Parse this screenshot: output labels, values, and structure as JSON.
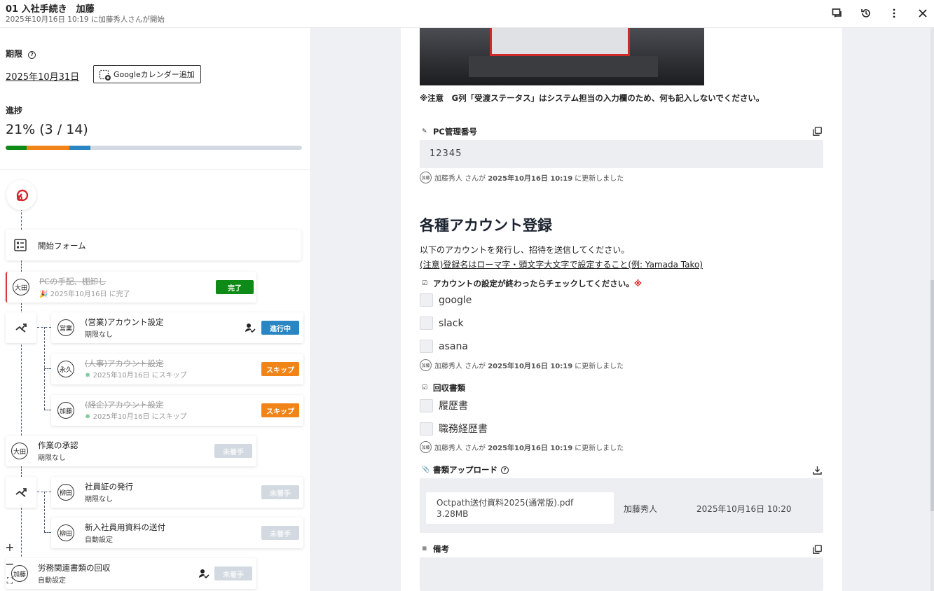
{
  "header": {
    "title": "01 入社手続き　加藤",
    "subtitle": "2025年10月16日 10:19 に加藤秀人さんが開始"
  },
  "deadline": {
    "label": "期限",
    "date": "2025年10月31日",
    "gcal_label": "Googleカレンダー追加"
  },
  "progress": {
    "label": "進捗",
    "value_text": "21% (3 / 14)",
    "done": 3,
    "total": 14,
    "segments": [
      {
        "color": "#0e8a16",
        "fraction": 0.0714
      },
      {
        "color": "#f08418",
        "fraction": 0.1429
      },
      {
        "color": "#2a86c2",
        "fraction": 0.0714
      }
    ]
  },
  "flow": {
    "start_form": "開始フォーム",
    "tasks": [
      {
        "avatar": "大田",
        "title": "PCの手配、棚卸し",
        "sub": "2025年10月16日 に完了",
        "badge": "完了"
      },
      {
        "avatar": "営業",
        "title": "(営業)アカウント設定",
        "sub": "期限なし",
        "badge": "進行中"
      },
      {
        "avatar": "永久",
        "title": "(人事)アカウント設定",
        "sub": "2025年10月16日 にスキップ",
        "badge": "スキップ"
      },
      {
        "avatar": "加藤",
        "title": "(経企)アカウント設定",
        "sub": "2025年10月16日 にスキップ",
        "badge": "スキップ"
      },
      {
        "avatar": "大田",
        "title": "作業の承認",
        "sub": "期限なし",
        "badge": "未着手"
      },
      {
        "avatar": "柳田",
        "title": "社員証の発行",
        "sub": "期限なし",
        "badge": "未着手"
      },
      {
        "avatar": "柳田",
        "title": "新入社員用資料の送付",
        "sub": "自動設定",
        "badge": "未着手"
      },
      {
        "avatar": "加藤",
        "title": "労務関連書類の回収",
        "sub": "自動設定",
        "badge": "未着手"
      }
    ]
  },
  "zoom": {
    "in": "+",
    "out": "−",
    "fit": "⛶"
  },
  "form": {
    "note": "※注意　G列「受渡ステータス」はシステム担当の入力欄のため、何も記入しないでください。",
    "pc_number": {
      "label": "PC管理番号",
      "value": "12345"
    },
    "meta_avatar": "加藤",
    "meta_user": "加藤秀人",
    "meta_san": "さんが",
    "meta_time": "2025年10月16日 10:19",
    "meta_suffix": "に更新しました",
    "section_title": "各種アカウント登録",
    "desc1": "以下のアカウントを発行し、招待を送信してください。",
    "desc2": "(注意)登録名はローマ字・頭文字大文字で設定すること(例: Yamada Tako)",
    "accounts": {
      "label": "アカウントの設定が終わったらチェックしてください。",
      "required_mark": "※",
      "options": [
        "google",
        "slack",
        "asana"
      ]
    },
    "documents": {
      "label": "回収書類",
      "options": [
        "履歴書",
        "職務経歴書"
      ]
    },
    "upload": {
      "label": "書類アップロード",
      "file_name": "Octpath送付資料2025(通常版).pdf",
      "file_size": "3.28MB",
      "uploader": "加藤秀人",
      "uploaded_at": "2025年10月16日 10:20"
    },
    "remarks": {
      "label": "備考"
    }
  }
}
